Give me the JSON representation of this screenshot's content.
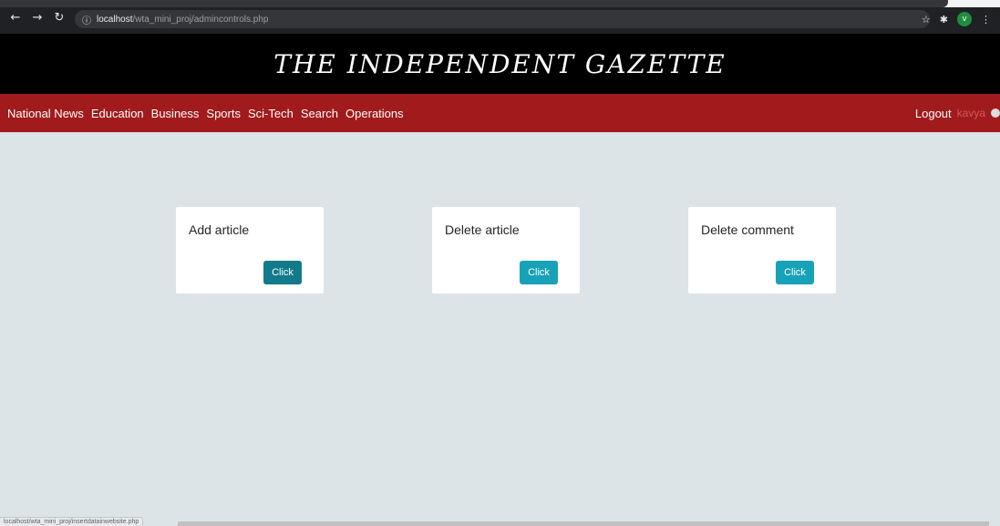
{
  "browser": {
    "url_host": "localhost",
    "url_path": "/wta_mini_proj/admincontrols.php",
    "profile_initial": "v",
    "status_url": "localhost/wta_mini_proj/insertdatainwebsite.php"
  },
  "site": {
    "title": "THE INDEPENDENT GAZETTE"
  },
  "nav": {
    "items": [
      "National News",
      "Education",
      "Business",
      "Sports",
      "Sci-Tech",
      "Search",
      "Operations"
    ],
    "logout_label": "Logout",
    "username": "kavya"
  },
  "cards": [
    {
      "heading": "Add article",
      "button_label": "Click"
    },
    {
      "heading": "Delete article",
      "button_label": "Click"
    },
    {
      "heading": "Delete comment",
      "button_label": "Click"
    }
  ],
  "colors": {
    "masthead_bg": "#000000",
    "navbar_bg": "#a11a1c",
    "page_bg": "#dde4e7",
    "button_bg": "#17a2b8"
  }
}
